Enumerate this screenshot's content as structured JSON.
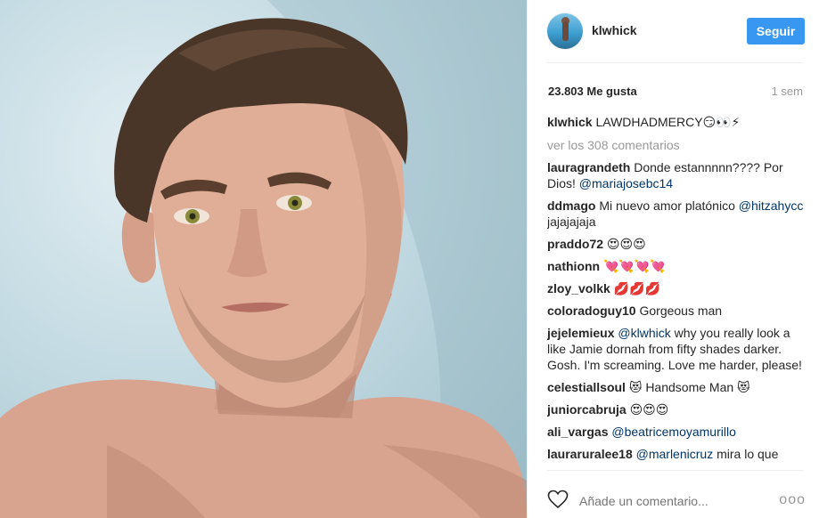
{
  "post": {
    "username": "klwhick",
    "follow_label": "Seguir",
    "likes": "23.803 Me gusta",
    "time": "1 sem"
  },
  "caption": {
    "user": "klwhick",
    "text": "LAWDHADMERCY",
    "emoji": "😏👀⚡"
  },
  "view_all": "ver los 308 comentarios",
  "comments": [
    {
      "user": "lauragrandeth",
      "pre": "Donde estannnnn???? Por Dios!",
      "mention": "@mariajosebc14",
      "post": ""
    },
    {
      "user": "ddmago",
      "pre": "Mi nuevo amor platónico",
      "mention": "@hitzahycc",
      "post": "jajajajaja"
    },
    {
      "user": "praddo72",
      "pre": "😍😍😍",
      "mention": "",
      "post": ""
    },
    {
      "user": "nathionn",
      "pre": "💘💘💘💘",
      "mention": "",
      "post": ""
    },
    {
      "user": "zloy_volkk",
      "pre": "💋💋💋",
      "mention": "",
      "post": ""
    },
    {
      "user": "coloradoguy10",
      "pre": "Gorgeous man",
      "mention": "",
      "post": ""
    },
    {
      "user": "jejelemieux",
      "pre": "",
      "mention": "@klwhick",
      "post": "why you really look a like Jamie dornah from fifty shades darker. Gosh. I'm screaming. Love me harder, please!"
    },
    {
      "user": "celestiallsoul",
      "pre": "😻 Handsome Man 😻",
      "mention": "",
      "post": ""
    },
    {
      "user": "juniorcabruja",
      "pre": "😍😍😍",
      "mention": "",
      "post": ""
    },
    {
      "user": "ali_vargas",
      "pre": "",
      "mention": "@beatricemoyamurillo",
      "post": ""
    },
    {
      "user": "lauraruralee18",
      "pre": "",
      "mention": "@marlenicruz",
      "post": "mira lo que"
    }
  ],
  "footer": {
    "comment_placeholder": "Añade un comentario...",
    "more": "ooo"
  },
  "colors": {
    "accent": "#3897f0",
    "mention": "#003569",
    "muted": "#999999"
  },
  "icons": {
    "like": "heart-icon",
    "options": "more-options-icon"
  }
}
